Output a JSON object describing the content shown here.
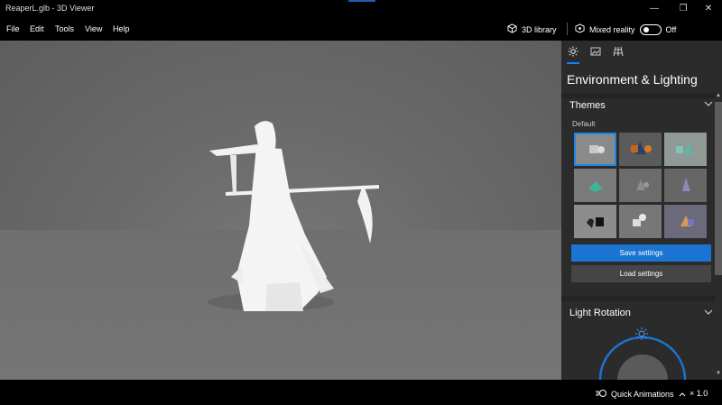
{
  "window": {
    "title": "ReaperL.glb - 3D Viewer",
    "minimize_glyph": "—",
    "maximize_glyph": "❐",
    "close_glyph": "✕"
  },
  "menu": {
    "items": [
      "File",
      "Edit",
      "Tools",
      "View",
      "Help"
    ]
  },
  "toolbar": {
    "library_label": "3D library",
    "mixed_reality_label": "Mixed reality",
    "mixed_reality_state": "Off"
  },
  "side_panel": {
    "tabs": [
      "sun-icon",
      "image-icon",
      "grid-icon"
    ],
    "title": "Environment & Lighting",
    "themes": {
      "heading": "Themes",
      "subheading": "Default",
      "selected_index": 0,
      "save_label": "Save settings",
      "load_label": "Load settings"
    },
    "light_rotation": {
      "heading": "Light Rotation"
    }
  },
  "status": {
    "quick_animations_label": "Quick Animations",
    "speed_label": "× 1.0"
  },
  "colors": {
    "accent": "#1a74d1",
    "panel_bg": "#2b2b2b",
    "viewport_bg": "#6c6c6c"
  }
}
